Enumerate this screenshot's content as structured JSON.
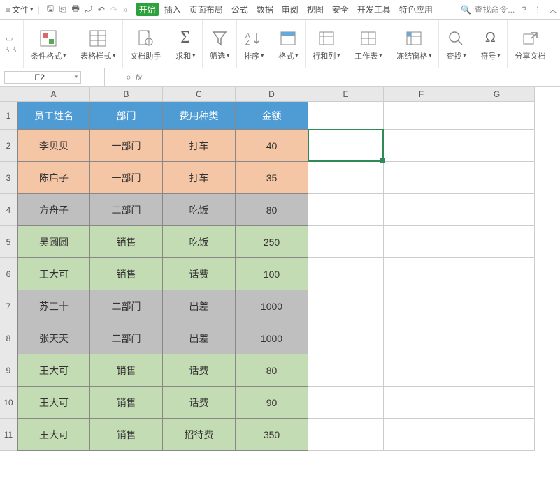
{
  "menubar": {
    "file": "文件",
    "tabs": [
      "开始",
      "插入",
      "页面布局",
      "公式",
      "数据",
      "审阅",
      "视图",
      "安全",
      "开发工具",
      "特色应用"
    ],
    "search_placeholder": "查找命令...",
    "active_tab_index": 0
  },
  "ribbon": {
    "small_left": [
      "☐",
      "▫▫"
    ],
    "items": [
      {
        "icon": "cond",
        "label": "条件格式",
        "drop": true
      },
      {
        "icon": "table",
        "label": "表格样式",
        "drop": true
      },
      {
        "icon": "doc",
        "label": "文档助手",
        "drop": false
      },
      {
        "icon": "sum",
        "label": "求和",
        "drop": true
      },
      {
        "icon": "filter",
        "label": "筛选",
        "drop": true
      },
      {
        "icon": "sort",
        "label": "排序",
        "drop": true
      },
      {
        "icon": "format",
        "label": "格式",
        "drop": true
      },
      {
        "icon": "rowcol",
        "label": "行和列",
        "drop": true
      },
      {
        "icon": "sheet",
        "label": "工作表",
        "drop": true
      },
      {
        "icon": "freeze",
        "label": "冻结窗格",
        "drop": true
      },
      {
        "icon": "find",
        "label": "查找",
        "drop": true
      },
      {
        "icon": "symbol",
        "label": "符号",
        "drop": true
      },
      {
        "icon": "share",
        "label": "分享文档",
        "drop": false
      }
    ]
  },
  "formulabar": {
    "namebox": "E2",
    "fx": "fx"
  },
  "columns": [
    "A",
    "B",
    "C",
    "D",
    "E",
    "F",
    "G"
  ],
  "header_row": [
    "员工姓名",
    "部门",
    "费用种类",
    "金额"
  ],
  "chart_data": {
    "type": "table",
    "columns": [
      "员工姓名",
      "部门",
      "费用种类",
      "金额"
    ],
    "rows": [
      {
        "name": "李贝贝",
        "dept": "一部门",
        "type": "打车",
        "amount": 40,
        "color": "orange"
      },
      {
        "name": "陈启子",
        "dept": "一部门",
        "type": "打车",
        "amount": 35,
        "color": "orange"
      },
      {
        "name": "方舟子",
        "dept": "二部门",
        "type": "吃饭",
        "amount": 80,
        "color": "gray"
      },
      {
        "name": "吴圆圆",
        "dept": "销售",
        "type": "吃饭",
        "amount": 250,
        "color": "green"
      },
      {
        "name": "王大可",
        "dept": "销售",
        "type": "话费",
        "amount": 100,
        "color": "green"
      },
      {
        "name": "苏三十",
        "dept": "二部门",
        "type": "出差",
        "amount": 1000,
        "color": "gray"
      },
      {
        "name": "张天天",
        "dept": "二部门",
        "type": "出差",
        "amount": 1000,
        "color": "gray"
      },
      {
        "name": "王大可",
        "dept": "销售",
        "type": "话费",
        "amount": 80,
        "color": "green"
      },
      {
        "name": "王大可",
        "dept": "销售",
        "type": "话费",
        "amount": 90,
        "color": "green"
      },
      {
        "name": "王大可",
        "dept": "销售",
        "type": "招待费",
        "amount": 350,
        "color": "green"
      }
    ]
  },
  "selected_cell": "E2"
}
